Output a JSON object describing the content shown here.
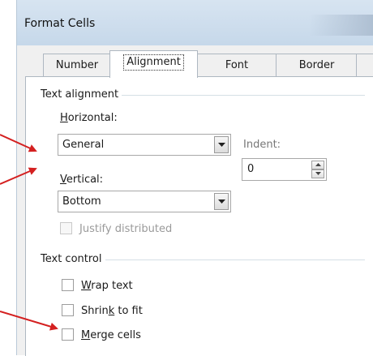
{
  "window": {
    "title": "Format Cells"
  },
  "tabs": [
    {
      "label": "Number"
    },
    {
      "label": "Alignment"
    },
    {
      "label": "Font"
    },
    {
      "label": "Border"
    }
  ],
  "text_alignment": {
    "group_label": "Text alignment",
    "horizontal_label": "Horizontal:",
    "horizontal_value": "General",
    "vertical_label": "Vertical:",
    "vertical_value": "Bottom",
    "indent_label": "Indent:",
    "indent_value": "0",
    "justify_distributed_label": "Justify distributed"
  },
  "text_control": {
    "group_label": "Text control",
    "wrap_text_label": "Wrap text",
    "shrink_to_fit_label": "Shrink to fit",
    "merge_cells_label": "Merge cells"
  },
  "colors": {
    "annotation_arrow": "#d42020"
  }
}
